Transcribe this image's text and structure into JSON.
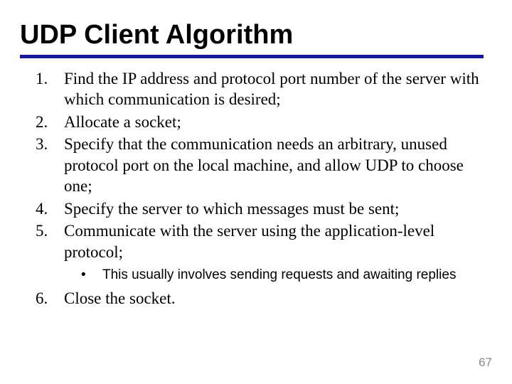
{
  "title": "UDP Client Algorithm",
  "rule_color": "#1a1a9a",
  "steps": {
    "s1": "Find the IP address and protocol port number of the server with which communication is desired;",
    "s2": "Allocate a socket;",
    "s3": "Specify that the communication needs an arbitrary, unused protocol port on the local machine, and allow UDP to choose one;",
    "s4": "Specify the server to which messages must be sent;",
    "s5": "Communicate with the server using the application-level protocol;",
    "s5_sub1": "This usually involves sending requests and awaiting replies",
    "s6": "Close the socket."
  },
  "page_number": "67"
}
